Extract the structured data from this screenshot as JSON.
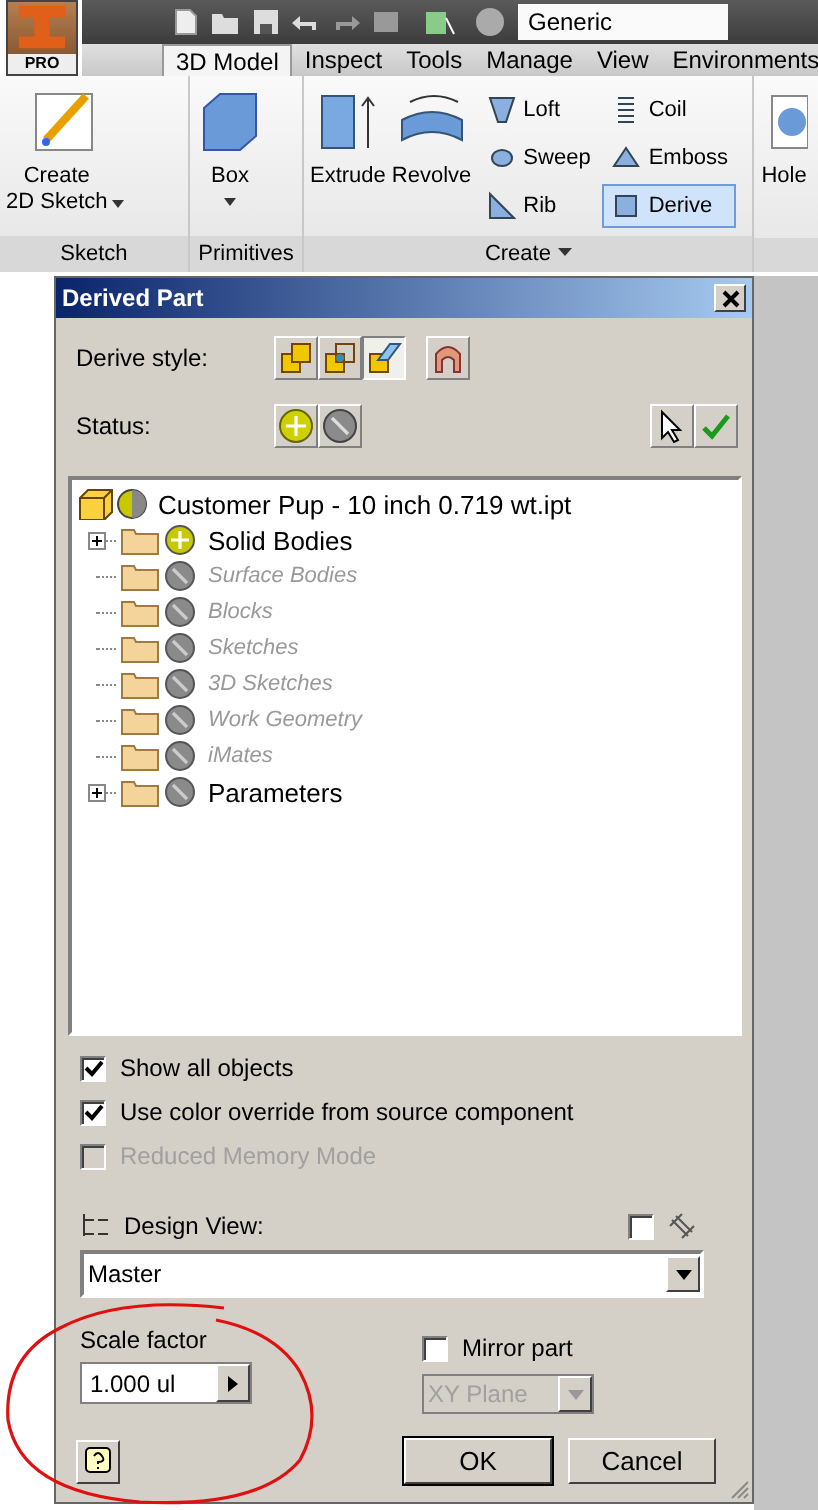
{
  "app_button": {
    "label": "PRO"
  },
  "quick_access": {
    "style_dropdown": "Generic"
  },
  "tabs": [
    {
      "label": "3D Model",
      "selected": true
    },
    {
      "label": "Inspect",
      "selected": false
    },
    {
      "label": "Tools",
      "selected": false
    },
    {
      "label": "Manage",
      "selected": false
    },
    {
      "label": "View",
      "selected": false
    },
    {
      "label": "Environments",
      "selected": false
    }
  ],
  "ribbon": {
    "sketch": {
      "label": "Sketch",
      "tool": {
        "label": "Create\n2D Sketch",
        "dropdown": true
      }
    },
    "primitives": {
      "label": "Primitives",
      "tool": {
        "label": "Box",
        "dropdown": true
      }
    },
    "create": {
      "label": "Create",
      "dropdown": true,
      "large": [
        {
          "label": "Extrude"
        },
        {
          "label": "Revolve"
        }
      ],
      "small": [
        {
          "label": "Loft",
          "selected": false
        },
        {
          "label": "Sweep",
          "selected": false
        },
        {
          "label": "Rib",
          "selected": false
        },
        {
          "label": "Coil",
          "selected": false
        },
        {
          "label": "Emboss",
          "selected": false
        },
        {
          "label": "Derive",
          "selected": true
        }
      ]
    },
    "partial_tool": {
      "label": "Hole"
    }
  },
  "dialog": {
    "title": "Derived Part",
    "derive_style": {
      "label": "Derive style:",
      "options": [
        {
          "selected": false
        },
        {
          "selected": false
        },
        {
          "selected": true
        },
        {
          "selected": false
        }
      ]
    },
    "status": {
      "label": "Status:"
    },
    "tree": {
      "root": {
        "label": "Customer Pup - 10 inch 0.719 wt.ipt",
        "kind": "mixed",
        "children": [
          {
            "label": "Solid Bodies",
            "kind": "include",
            "expandable": true,
            "disabled": false
          },
          {
            "label": "Surface Bodies",
            "kind": "exclude",
            "expandable": false,
            "disabled": true
          },
          {
            "label": "Blocks",
            "kind": "exclude",
            "expandable": false,
            "disabled": true
          },
          {
            "label": "Sketches",
            "kind": "exclude",
            "expandable": false,
            "disabled": true
          },
          {
            "label": "3D Sketches",
            "kind": "exclude",
            "expandable": false,
            "disabled": true
          },
          {
            "label": "Work Geometry",
            "kind": "exclude",
            "expandable": false,
            "disabled": true
          },
          {
            "label": "iMates",
            "kind": "exclude",
            "expandable": false,
            "disabled": true
          },
          {
            "label": "Parameters",
            "kind": "exclude",
            "expandable": true,
            "disabled": false
          }
        ]
      }
    },
    "options": [
      {
        "label": "Show all objects",
        "checked": true,
        "disabled": false
      },
      {
        "label": "Use color override from source component",
        "checked": true,
        "disabled": false
      },
      {
        "label": "Reduced Memory Mode",
        "checked": false,
        "disabled": true
      }
    ],
    "design_view": {
      "label": "Design View:",
      "linked": false,
      "value": "Master"
    },
    "scale_factor": {
      "label": "Scale factor",
      "value": "1.000 ul"
    },
    "mirror": {
      "label": "Mirror part",
      "checked": false,
      "plane": "XY Plane",
      "plane_disabled": true
    },
    "buttons": [
      "OK",
      "Cancel"
    ]
  }
}
